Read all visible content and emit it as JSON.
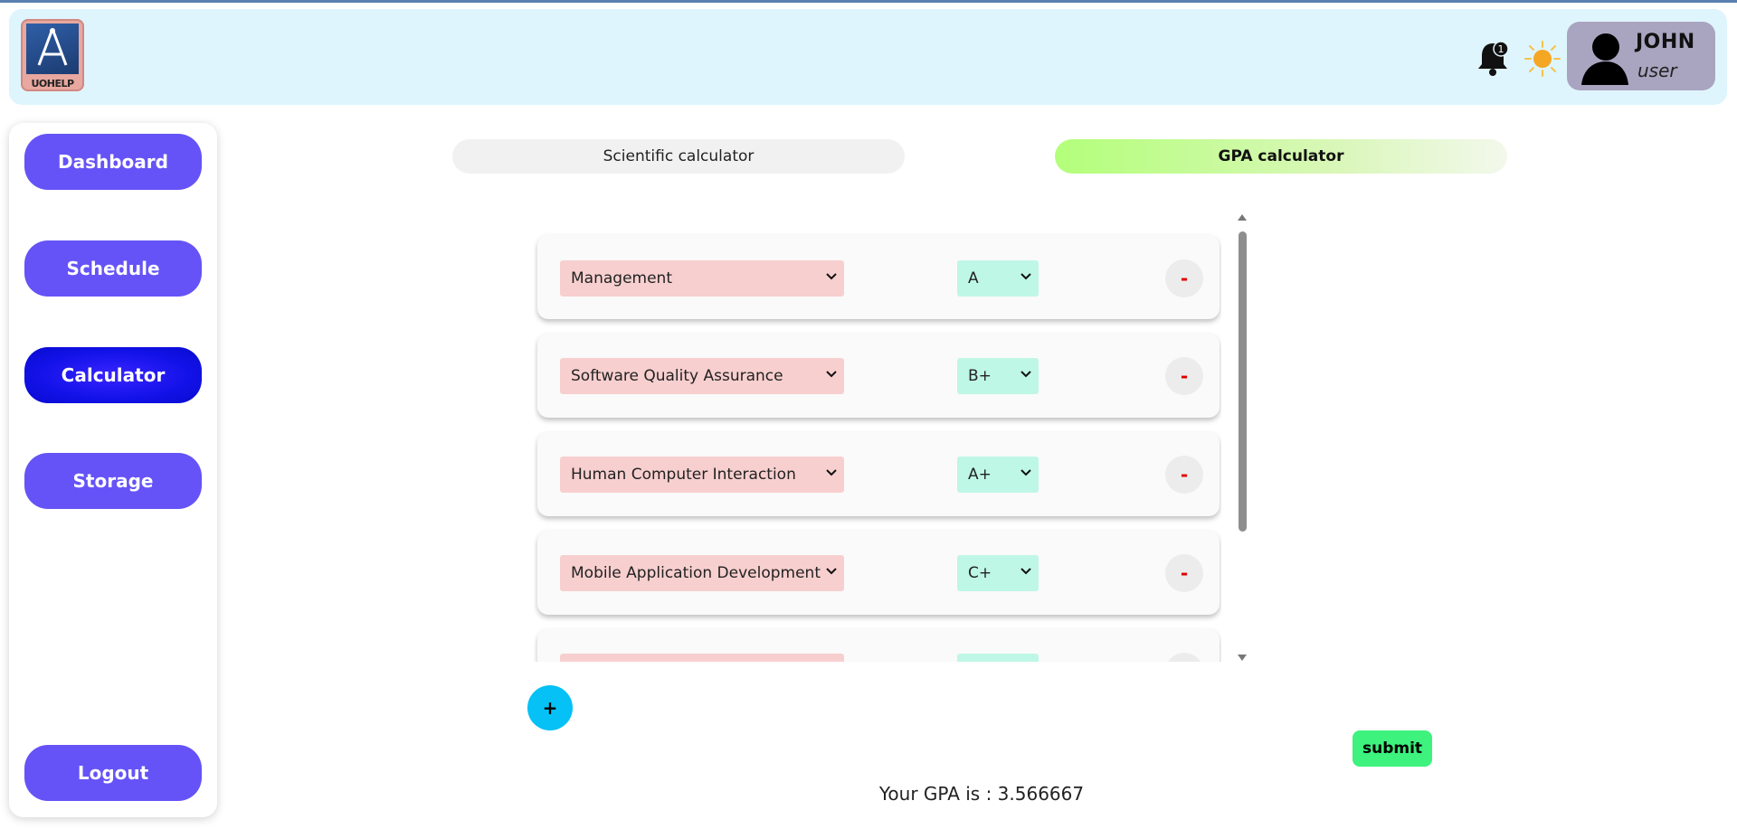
{
  "header": {
    "logo_text": "UOHELP",
    "notification_count": "1",
    "user": {
      "name": "JOHN",
      "role": "user"
    }
  },
  "sidebar": {
    "items": [
      {
        "label": "Dashboard"
      },
      {
        "label": "Schedule"
      },
      {
        "label": "Calculator",
        "active": true
      },
      {
        "label": "Storage"
      },
      {
        "label": "Logout"
      }
    ]
  },
  "tabs": {
    "scientific": "Scientific calculator",
    "gpa": "GPA calculator",
    "active": "gpa"
  },
  "courses": [
    {
      "course": "Management",
      "grade": "A",
      "remove_label": "-"
    },
    {
      "course": "Software Quality Assurance",
      "grade": "B+",
      "remove_label": "-"
    },
    {
      "course": "Human Computer Interaction",
      "grade": "A+",
      "remove_label": "-"
    },
    {
      "course": "Mobile Application Development",
      "grade": "C+",
      "remove_label": "-"
    }
  ],
  "actions": {
    "add_label": "+",
    "submit_label": "submit"
  },
  "result": {
    "text": "Your GPA is : 3.566667"
  },
  "colors": {
    "nav_button": "#6553f7",
    "nav_active": "#1212e8",
    "course_select": "#f8cfcf",
    "grade_select": "#bff7e6",
    "add_button": "#05c1f5",
    "submit_button": "#3df27d",
    "remove_minus": "#e00000"
  }
}
